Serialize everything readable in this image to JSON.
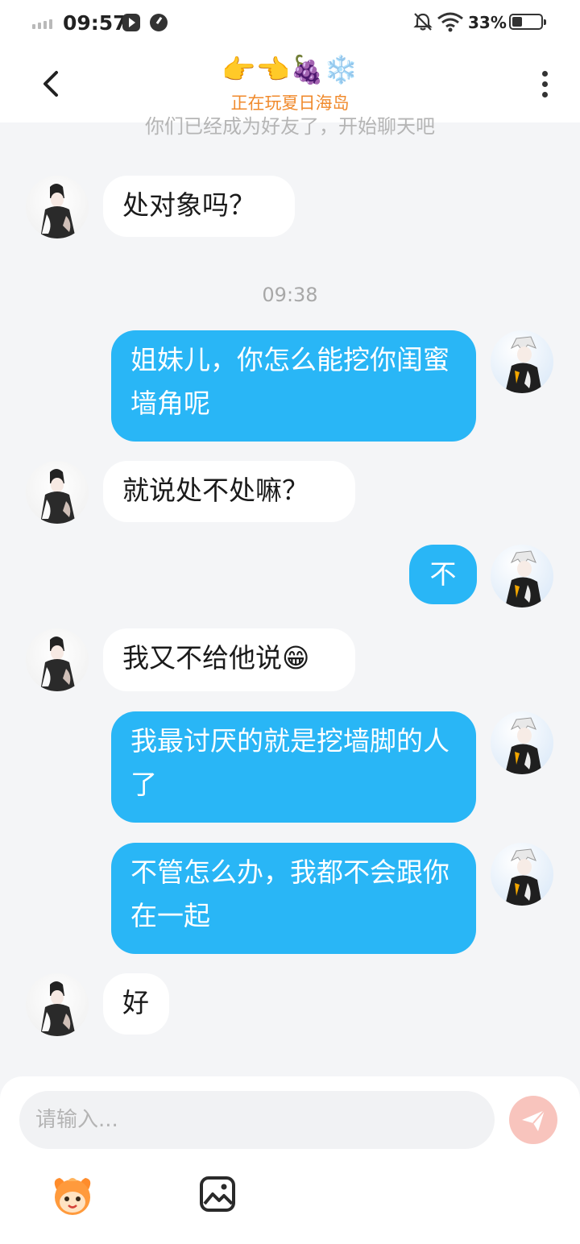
{
  "status_bar": {
    "time": "09:57",
    "battery": "33%"
  },
  "header": {
    "title_emoji": "👉👈🍇❄️",
    "status": "正在玩夏日海岛"
  },
  "system_tip": "你们已经成为好友了，开始聊天吧",
  "messages": [
    {
      "from": "peer",
      "text": "处对象吗？"
    },
    {
      "time": "09:38"
    },
    {
      "from": "me",
      "text": "姐妹儿，你怎么能挖你闺蜜墙角呢"
    },
    {
      "from": "peer",
      "text": "就说处不处嘛？"
    },
    {
      "from": "me",
      "text": "不"
    },
    {
      "from": "peer",
      "text": "我又不给他说😁"
    },
    {
      "from": "me",
      "text": "我最讨厌的就是挖墙脚的人了"
    },
    {
      "from": "me",
      "text": "不管怎么办，我都不会跟你在一起"
    },
    {
      "from": "peer",
      "text": "好"
    }
  ],
  "input": {
    "placeholder": "请输入..."
  },
  "colors": {
    "my_bubble": "#29b6f6",
    "peer_bubble": "#ffffff",
    "status_orange": "#f08a2c",
    "send_button": "#f8c4bd"
  },
  "icons": [
    "back-arrow-icon",
    "more-dots-icon",
    "send-icon",
    "mascot-emoji-icon",
    "gallery-icon"
  ]
}
